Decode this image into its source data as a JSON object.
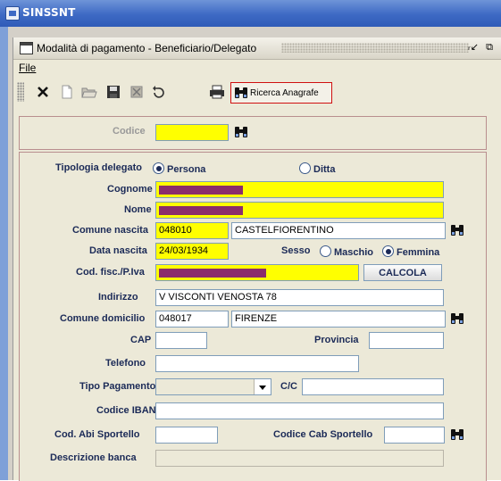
{
  "app": {
    "title": "SINSSNT"
  },
  "window": {
    "title": "Modalità di pagamento - Beneficiario/Delegato",
    "ctrl_min": "ᵣ↙",
    "ctrl_max": "⧉"
  },
  "menu": {
    "file": "File"
  },
  "toolbar": {
    "icons": [
      "close-icon",
      "new-document-icon",
      "open-folder-icon",
      "save-icon",
      "delete-icon",
      "undo-icon",
      "print-icon"
    ],
    "ricerca_label": "Ricerca Anagrafe"
  },
  "search": {
    "codice_label": "Codice",
    "codice_value": ""
  },
  "form": {
    "tipologia_label": "Tipologia delegato",
    "tipologia_options": [
      "Persona",
      "Ditta"
    ],
    "tipologia_selected": "Persona",
    "cognome_label": "Cognome",
    "nome_label": "Nome",
    "comune_nascita_label": "Comune nascita",
    "comune_nascita_code": "048010",
    "comune_nascita_name": "CASTELFIORENTINO",
    "data_nascita_label": "Data nascita",
    "data_nascita_value": "24/03/1934",
    "sesso_label": "Sesso",
    "sesso_options": [
      "Maschio",
      "Femmina"
    ],
    "sesso_selected": "Femmina",
    "codfisc_label": "Cod. fisc./P.Iva",
    "calcola_label": "CALCOLA",
    "indirizzo_label": "Indirizzo",
    "indirizzo_value": "V VISCONTI VENOSTA 78",
    "comune_domicilio_label": "Comune domicilio",
    "comune_domicilio_code": "048017",
    "comune_domicilio_name": "FIRENZE",
    "cap_label": "CAP",
    "cap_value": "",
    "provincia_label": "Provincia",
    "provincia_value": "",
    "telefono_label": "Telefono",
    "telefono_value": "",
    "tipo_pagamento_label": "Tipo Pagamento",
    "tipo_pagamento_value": "",
    "cc_label": "C/C",
    "cc_value": "",
    "iban_label": "Codice IBAN",
    "iban_value": "",
    "abi_label": "Cod. Abi Sportello",
    "abi_value": "",
    "cab_label": "Codice Cab Sportello",
    "cab_value": "",
    "descrizione_banca_label": "Descrizione banca",
    "descrizione_banca_value": ""
  },
  "colors": {
    "required_field": "#ffff00",
    "redaction": "#8b2d6b",
    "label": "#1b2a57",
    "highlight_border": "#d01010"
  }
}
